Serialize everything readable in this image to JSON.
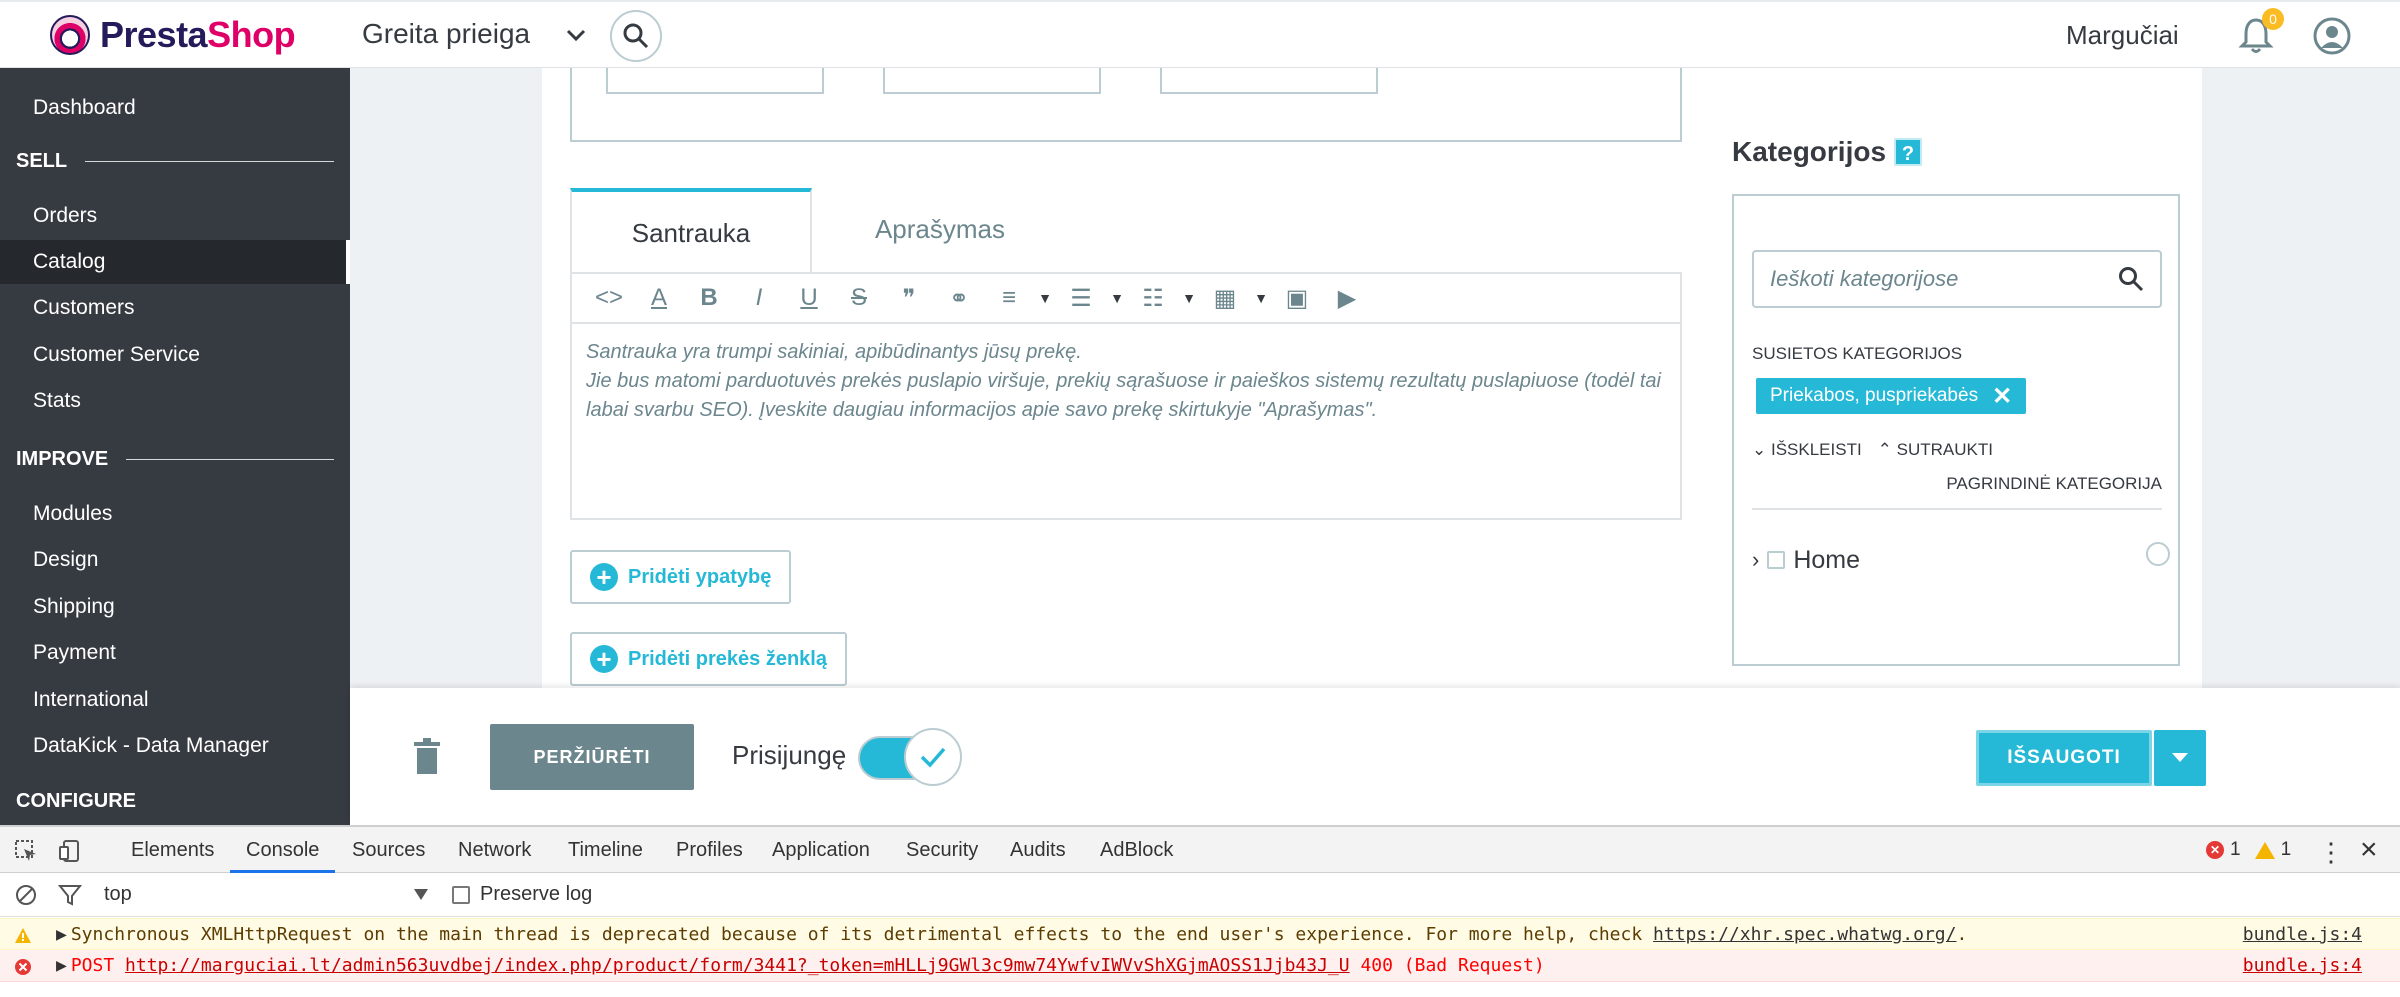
{
  "header": {
    "logo_first": "Presta",
    "logo_second": "Shop",
    "quick_access": "Greita prieiga",
    "shop_name": "Margučiai",
    "notifications_count": "0"
  },
  "sidebar": {
    "items": [
      {
        "label": "Dashboard"
      },
      {
        "label": "Orders"
      },
      {
        "label": "Catalog"
      },
      {
        "label": "Customers"
      },
      {
        "label": "Customer Service"
      },
      {
        "label": "Stats"
      },
      {
        "label": "Modules"
      },
      {
        "label": "Design"
      },
      {
        "label": "Shipping"
      },
      {
        "label": "Payment"
      },
      {
        "label": "International"
      },
      {
        "label": "DataKick - Data Manager"
      }
    ],
    "sections": {
      "sell": "SELL",
      "improve": "IMPROVE",
      "configure": "CONFIGURE"
    }
  },
  "product": {
    "tabs": [
      {
        "label": "Santrauka"
      },
      {
        "label": "Aprašymas"
      }
    ],
    "summary_text_line1": "Santrauka yra trumpi sakiniai, apibūdinantys jūsų prekę.",
    "summary_text_line2": "Jie bus matomi parduotuvės prekės puslapio viršuje, prekių sąrašuose ir paieškos sistemų rezultatų puslapiuose (todėl tai labai svarbu SEO). Įveskite daugiau informacijos apie savo prekę skirtukyje \"Aprašymas\".",
    "add_feature": "Pridėti ypatybę",
    "add_brand": "Pridėti prekės ženklą"
  },
  "categories": {
    "title": "Kategorijos",
    "help": "?",
    "search_placeholder": "Ieškoti kategorijose",
    "associated_label": "SUSIETOS KATEGORIJOS",
    "chip_label": "Priekabos, puspriekabės",
    "expand": "IŠSKLEISTI",
    "collapse": "SUTRAUKTI",
    "main_category": "PAGRINDINĖ KATEGORIJA",
    "tree_root": "Home"
  },
  "footer": {
    "preview": "PERŽIŪRĖTI",
    "online_label": "Prisijungę",
    "online": true,
    "save": "IŠSAUGOTI"
  },
  "devtools": {
    "tabs": [
      {
        "label": "Elements"
      },
      {
        "label": "Console"
      },
      {
        "label": "Sources"
      },
      {
        "label": "Network"
      },
      {
        "label": "Timeline"
      },
      {
        "label": "Profiles"
      },
      {
        "label": "Application"
      },
      {
        "label": "Security"
      },
      {
        "label": "Audits"
      },
      {
        "label": "AdBlock"
      }
    ],
    "error_count": "1",
    "warning_count": "1",
    "context": "top",
    "preserve_log": "Preserve log",
    "warn_text": "Synchronous XMLHttpRequest on the main thread is deprecated because of its detrimental effects to the end user's experience. For more help, check ",
    "warn_link": "https://xhr.spec.whatwg.org/",
    "warn_tail": ".",
    "err_method": "POST ",
    "err_url": "http://marguciai.lt/admin563uvdbej/index.php/product/form/3441?_token=mHLLj9GWl3c9mw74YwfvIWVvShXGjmAOSS1Jjb43J_U",
    "err_status": " 400 (Bad Request)",
    "source": "bundle.js:4"
  },
  "colors": {
    "brand_primary": "#25b9d7",
    "sidebar_bg": "#363a41",
    "logo_dark": "#251b5b",
    "logo_pink": "#df0067"
  }
}
